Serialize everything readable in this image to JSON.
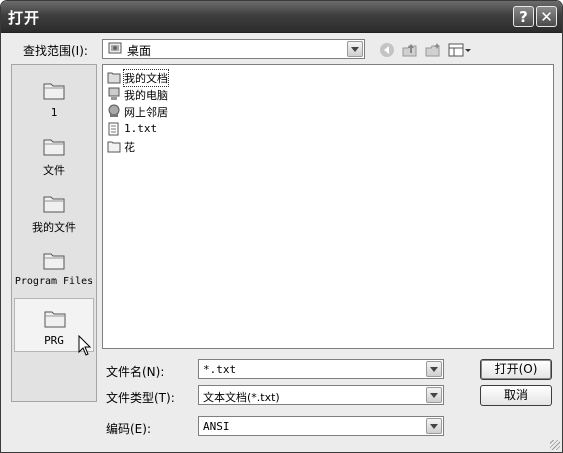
{
  "window": {
    "title": "打开",
    "help_button": "?",
    "close_button": "✕"
  },
  "lookin": {
    "label": "查找范围(I):",
    "value": "桌面"
  },
  "toolbar": {
    "icons": [
      "back-icon",
      "up-folder-icon",
      "new-folder-icon",
      "view-menu-icon"
    ]
  },
  "places": [
    {
      "label": "1",
      "icon": "folder-icon"
    },
    {
      "label": "文件",
      "icon": "folder-icon"
    },
    {
      "label": "我的文件",
      "icon": "folder-icon"
    },
    {
      "label": "Program Files",
      "icon": "folder-icon"
    },
    {
      "label": "PRG",
      "icon": "folder-icon"
    }
  ],
  "files": [
    {
      "name": "我的文档",
      "icon": "my-documents-icon"
    },
    {
      "name": "我的电脑",
      "icon": "my-computer-icon"
    },
    {
      "name": "网上邻居",
      "icon": "network-places-icon"
    },
    {
      "name": "1.txt",
      "icon": "text-file-icon"
    },
    {
      "name": "花",
      "icon": "folder-icon"
    }
  ],
  "filename": {
    "label": "文件名(N):",
    "value": "*.txt"
  },
  "filetype": {
    "label": "文件类型(T):",
    "value": "文本文档(*.txt)"
  },
  "encoding": {
    "label": "编码(E):",
    "value": "ANSI"
  },
  "buttons": {
    "open": "打开(O)",
    "cancel": "取消"
  }
}
